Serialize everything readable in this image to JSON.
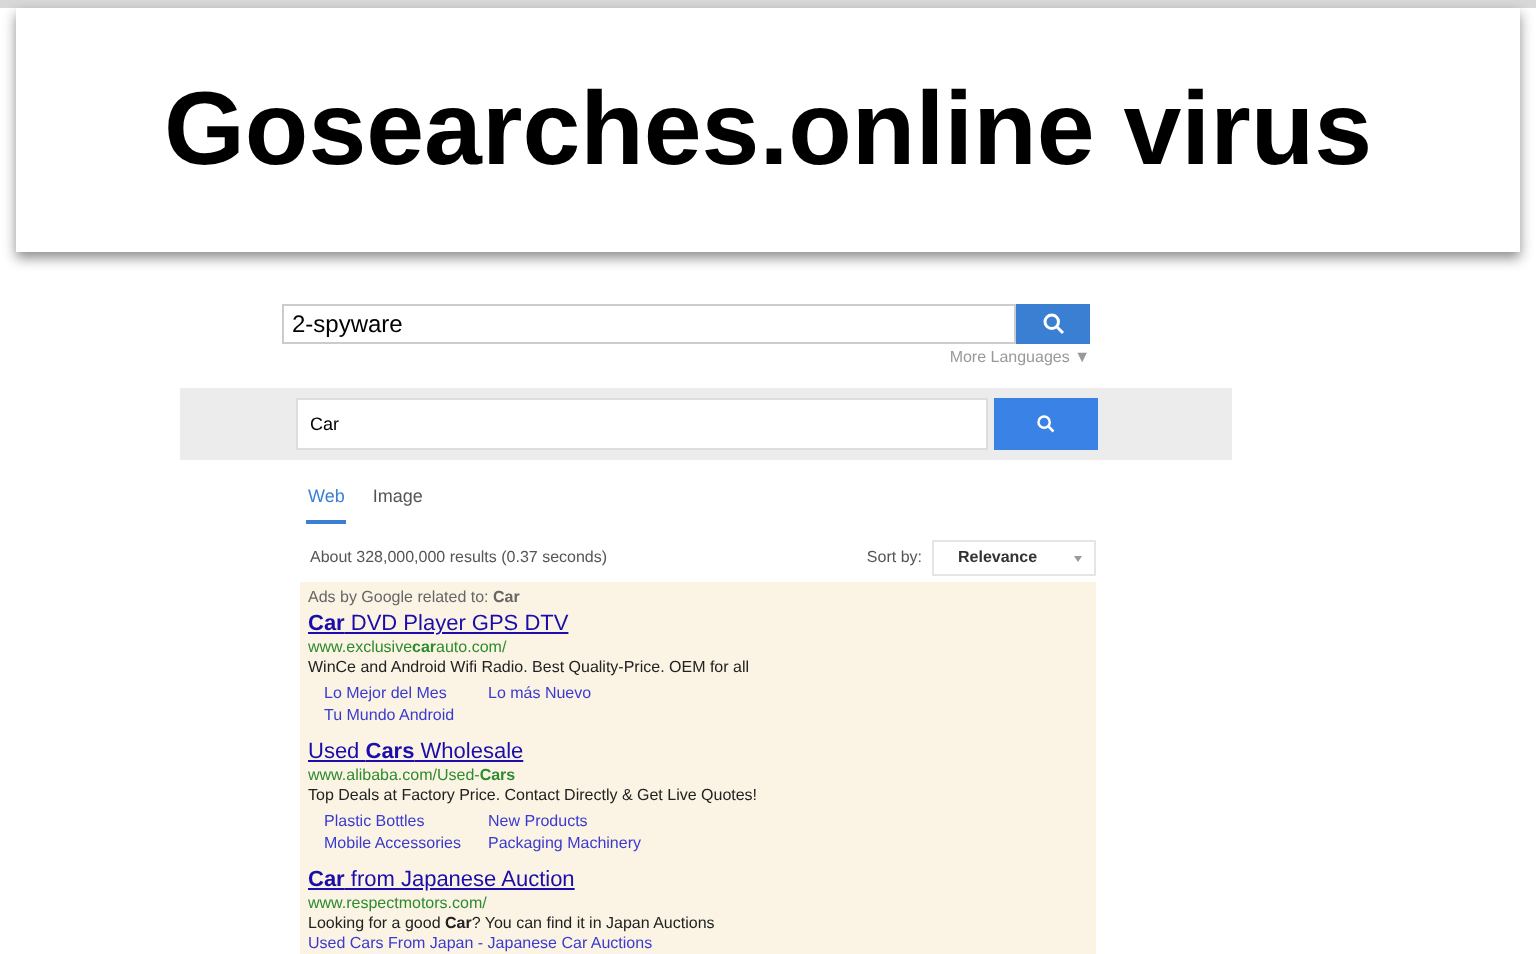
{
  "banner": {
    "title": "Gosearches.online virus"
  },
  "top_search": {
    "value": "2-spyware",
    "more_languages": "More Languages ▼"
  },
  "search": {
    "value": "Car"
  },
  "tabs": [
    {
      "label": "Web",
      "selected": true
    },
    {
      "label": "Image",
      "selected": false
    }
  ],
  "results_info": "About 328,000,000 results (0.37 seconds)",
  "sort": {
    "label": "Sort by:",
    "value": "Relevance"
  },
  "ads": {
    "header": "Ads by Google related to: **Car**",
    "items": [
      {
        "title": "**Car** DVD Player GPS DTV",
        "url": "www.exclusive**car**auto.com/",
        "description": "WinCe and Android Wifi Radio. Best Quality-Price. OEM for all",
        "links": [
          [
            "Lo Mejor del Mes",
            "Lo más Nuevo"
          ],
          [
            "Tu Mundo Android"
          ]
        ]
      },
      {
        "title": "Used **Cars** Wholesale",
        "url": "www.alibaba.com/Used-**Cars**",
        "description": "Top Deals at Factory Price. Contact Directly & Get Live Quotes!",
        "links": [
          [
            "Plastic Bottles",
            "New Products"
          ],
          [
            "Mobile Accessories",
            "Packaging Machinery"
          ]
        ]
      },
      {
        "title": "**Car** from Japanese Auction",
        "url": "www.respectmotors.com/",
        "description": "Looking for a good **Car**? You can find it in Japan Auctions",
        "links": [
          [
            "Used Cars From Japan - Japanese Car Auctions"
          ]
        ]
      }
    ]
  }
}
